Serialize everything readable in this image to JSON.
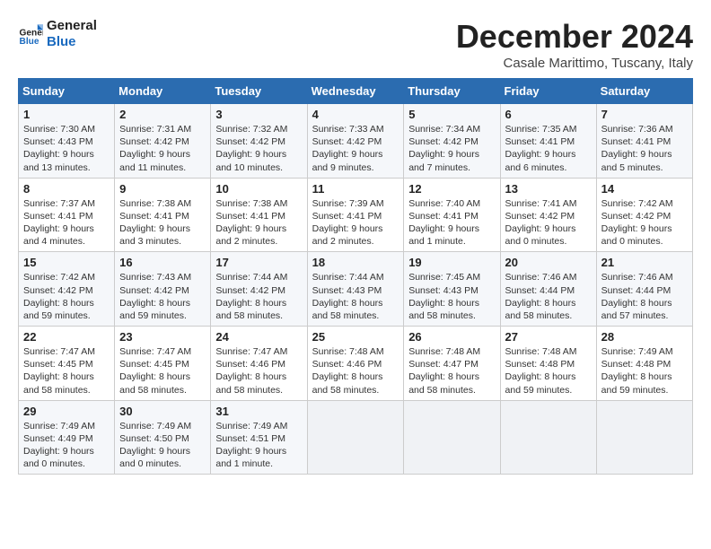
{
  "header": {
    "logo_line1": "General",
    "logo_line2": "Blue",
    "month_title": "December 2024",
    "subtitle": "Casale Marittimo, Tuscany, Italy"
  },
  "days_of_week": [
    "Sunday",
    "Monday",
    "Tuesday",
    "Wednesday",
    "Thursday",
    "Friday",
    "Saturday"
  ],
  "weeks": [
    [
      {
        "day": "1",
        "sunrise": "7:30 AM",
        "sunset": "4:43 PM",
        "daylight": "9 hours and 13 minutes."
      },
      {
        "day": "2",
        "sunrise": "7:31 AM",
        "sunset": "4:42 PM",
        "daylight": "9 hours and 11 minutes."
      },
      {
        "day": "3",
        "sunrise": "7:32 AM",
        "sunset": "4:42 PM",
        "daylight": "9 hours and 10 minutes."
      },
      {
        "day": "4",
        "sunrise": "7:33 AM",
        "sunset": "4:42 PM",
        "daylight": "9 hours and 9 minutes."
      },
      {
        "day": "5",
        "sunrise": "7:34 AM",
        "sunset": "4:42 PM",
        "daylight": "9 hours and 7 minutes."
      },
      {
        "day": "6",
        "sunrise": "7:35 AM",
        "sunset": "4:41 PM",
        "daylight": "9 hours and 6 minutes."
      },
      {
        "day": "7",
        "sunrise": "7:36 AM",
        "sunset": "4:41 PM",
        "daylight": "9 hours and 5 minutes."
      }
    ],
    [
      {
        "day": "8",
        "sunrise": "7:37 AM",
        "sunset": "4:41 PM",
        "daylight": "9 hours and 4 minutes."
      },
      {
        "day": "9",
        "sunrise": "7:38 AM",
        "sunset": "4:41 PM",
        "daylight": "9 hours and 3 minutes."
      },
      {
        "day": "10",
        "sunrise": "7:38 AM",
        "sunset": "4:41 PM",
        "daylight": "9 hours and 2 minutes."
      },
      {
        "day": "11",
        "sunrise": "7:39 AM",
        "sunset": "4:41 PM",
        "daylight": "9 hours and 2 minutes."
      },
      {
        "day": "12",
        "sunrise": "7:40 AM",
        "sunset": "4:41 PM",
        "daylight": "9 hours and 1 minute."
      },
      {
        "day": "13",
        "sunrise": "7:41 AM",
        "sunset": "4:42 PM",
        "daylight": "9 hours and 0 minutes."
      },
      {
        "day": "14",
        "sunrise": "7:42 AM",
        "sunset": "4:42 PM",
        "daylight": "9 hours and 0 minutes."
      }
    ],
    [
      {
        "day": "15",
        "sunrise": "7:42 AM",
        "sunset": "4:42 PM",
        "daylight": "8 hours and 59 minutes."
      },
      {
        "day": "16",
        "sunrise": "7:43 AM",
        "sunset": "4:42 PM",
        "daylight": "8 hours and 59 minutes."
      },
      {
        "day": "17",
        "sunrise": "7:44 AM",
        "sunset": "4:42 PM",
        "daylight": "8 hours and 58 minutes."
      },
      {
        "day": "18",
        "sunrise": "7:44 AM",
        "sunset": "4:43 PM",
        "daylight": "8 hours and 58 minutes."
      },
      {
        "day": "19",
        "sunrise": "7:45 AM",
        "sunset": "4:43 PM",
        "daylight": "8 hours and 58 minutes."
      },
      {
        "day": "20",
        "sunrise": "7:46 AM",
        "sunset": "4:44 PM",
        "daylight": "8 hours and 58 minutes."
      },
      {
        "day": "21",
        "sunrise": "7:46 AM",
        "sunset": "4:44 PM",
        "daylight": "8 hours and 57 minutes."
      }
    ],
    [
      {
        "day": "22",
        "sunrise": "7:47 AM",
        "sunset": "4:45 PM",
        "daylight": "8 hours and 58 minutes."
      },
      {
        "day": "23",
        "sunrise": "7:47 AM",
        "sunset": "4:45 PM",
        "daylight": "8 hours and 58 minutes."
      },
      {
        "day": "24",
        "sunrise": "7:47 AM",
        "sunset": "4:46 PM",
        "daylight": "8 hours and 58 minutes."
      },
      {
        "day": "25",
        "sunrise": "7:48 AM",
        "sunset": "4:46 PM",
        "daylight": "8 hours and 58 minutes."
      },
      {
        "day": "26",
        "sunrise": "7:48 AM",
        "sunset": "4:47 PM",
        "daylight": "8 hours and 58 minutes."
      },
      {
        "day": "27",
        "sunrise": "7:48 AM",
        "sunset": "4:48 PM",
        "daylight": "8 hours and 59 minutes."
      },
      {
        "day": "28",
        "sunrise": "7:49 AM",
        "sunset": "4:48 PM",
        "daylight": "8 hours and 59 minutes."
      }
    ],
    [
      {
        "day": "29",
        "sunrise": "7:49 AM",
        "sunset": "4:49 PM",
        "daylight": "9 hours and 0 minutes."
      },
      {
        "day": "30",
        "sunrise": "7:49 AM",
        "sunset": "4:50 PM",
        "daylight": "9 hours and 0 minutes."
      },
      {
        "day": "31",
        "sunrise": "7:49 AM",
        "sunset": "4:51 PM",
        "daylight": "9 hours and 1 minute."
      },
      null,
      null,
      null,
      null
    ]
  ],
  "labels": {
    "sunrise": "Sunrise:",
    "sunset": "Sunset:",
    "daylight": "Daylight:"
  }
}
